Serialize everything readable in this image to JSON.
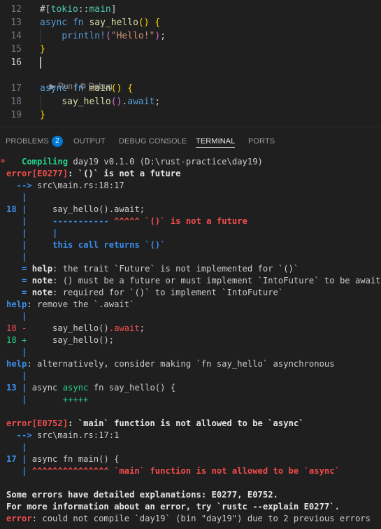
{
  "editor": {
    "lines": [
      {
        "num": "12",
        "parts": [
          [
            "#[",
            "t-attr"
          ],
          [
            "tokio",
            "t-path"
          ],
          [
            "::",
            "t-attr"
          ],
          [
            "main",
            "t-path"
          ],
          [
            "]",
            "t-attr"
          ]
        ]
      },
      {
        "num": "13",
        "parts": [
          [
            "async",
            "t-kw"
          ],
          [
            " ",
            "t-punc"
          ],
          [
            "fn",
            "t-kw"
          ],
          [
            " ",
            "t-punc"
          ],
          [
            "say_hello",
            "t-fn"
          ],
          [
            "()",
            "t-b1"
          ],
          [
            " ",
            "t-punc"
          ],
          [
            "{",
            "t-b1"
          ]
        ]
      },
      {
        "num": "14",
        "parts": [
          [
            "    ",
            "t-punc"
          ],
          [
            "println!",
            "t-kw"
          ],
          [
            "(",
            "t-b2"
          ],
          [
            "\"Hello!\"",
            "t-str"
          ],
          [
            ")",
            "t-b2"
          ],
          [
            ";",
            "t-punc"
          ]
        ]
      },
      {
        "num": "15",
        "parts": [
          [
            "}",
            "t-b1"
          ]
        ]
      },
      {
        "num": "16",
        "parts": []
      },
      {
        "num": "17",
        "parts": [
          [
            "async",
            "t-kw"
          ],
          [
            " ",
            "t-punc"
          ],
          [
            "fn",
            "t-kw"
          ],
          [
            " ",
            "t-punc"
          ],
          [
            "main",
            "t-fn"
          ],
          [
            "()",
            "t-b1"
          ],
          [
            " ",
            "t-punc"
          ],
          [
            "{",
            "t-b1"
          ]
        ]
      },
      {
        "num": "18",
        "parts": [
          [
            "    ",
            "t-punc"
          ],
          [
            "say_hello",
            "t-fn"
          ],
          [
            "()",
            "t-b2"
          ],
          [
            ".",
            "t-punc"
          ],
          [
            "await",
            "t-kw"
          ],
          [
            ";",
            "t-punc"
          ]
        ]
      },
      {
        "num": "19",
        "parts": [
          [
            "}",
            "t-b1"
          ]
        ]
      }
    ],
    "codelens": {
      "run_label": "Run",
      "separator": " | ",
      "debug_label": "Debug"
    }
  },
  "panel": {
    "tabs": [
      {
        "label": "PROBLEMS",
        "badge": "2",
        "active": false
      },
      {
        "label": "OUTPUT",
        "active": false
      },
      {
        "label": "DEBUG CONSOLE",
        "active": false
      },
      {
        "label": "TERMINAL",
        "active": true
      },
      {
        "label": "PORTS",
        "active": false
      }
    ]
  },
  "terminal": {
    "lines": [
      [
        [
          "   Compiling",
          "c-green c-bold"
        ],
        [
          " day19 v0.1.0 (D:\\rust-practice\\day19)",
          "c-norm"
        ]
      ],
      [
        [
          "error[E0277]",
          "c-red c-bold"
        ],
        [
          ": `()` is not a future",
          "c-white c-bold"
        ]
      ],
      [
        [
          "  --> ",
          "c-blue c-bold"
        ],
        [
          "src\\main.rs:18:17",
          "c-norm"
        ]
      ],
      [
        [
          "   |",
          "c-blue c-bold"
        ]
      ],
      [
        [
          "18 |",
          "c-blue c-bold"
        ],
        [
          "     say_hello().await;",
          "c-norm"
        ]
      ],
      [
        [
          "   |",
          "c-blue c-bold"
        ],
        [
          "     ----------- ",
          "c-blue c-bold"
        ],
        [
          "^^^^^ `()` is not a future",
          "c-red c-bold"
        ]
      ],
      [
        [
          "   |",
          "c-blue c-bold"
        ],
        [
          "     |",
          "c-blue c-bold"
        ]
      ],
      [
        [
          "   |",
          "c-blue c-bold"
        ],
        [
          "     this call returns `()`",
          "c-blue c-bold"
        ]
      ],
      [
        [
          "   |",
          "c-blue c-bold"
        ]
      ],
      [
        [
          "   = ",
          "c-blue c-bold"
        ],
        [
          "help",
          "c-white c-bold"
        ],
        [
          ": the trait `Future` is not implemented for `()`",
          "c-norm"
        ]
      ],
      [
        [
          "   = ",
          "c-blue c-bold"
        ],
        [
          "note",
          "c-white c-bold"
        ],
        [
          ": () must be a future or must implement `IntoFuture` to be awaited",
          "c-norm"
        ]
      ],
      [
        [
          "   = ",
          "c-blue c-bold"
        ],
        [
          "note",
          "c-white c-bold"
        ],
        [
          ": required for `()` to implement `IntoFuture`",
          "c-norm"
        ]
      ],
      [
        [
          "help",
          "c-blue c-bold"
        ],
        [
          ": remove the `.await`",
          "c-norm"
        ]
      ],
      [
        [
          "   |",
          "c-blue c-bold"
        ]
      ],
      [
        [
          "18 - ",
          "c-red"
        ],
        [
          "    say_hello()",
          "c-norm"
        ],
        [
          ".await",
          "c-red"
        ],
        [
          ";",
          "c-norm"
        ]
      ],
      [
        [
          "18 + ",
          "c-green"
        ],
        [
          "    say_hello();",
          "c-norm"
        ]
      ],
      [
        [
          "   |",
          "c-blue c-bold"
        ]
      ],
      [
        [
          "help",
          "c-blue c-bold"
        ],
        [
          ": alternatively, consider making `fn say_hello` asynchronous",
          "c-norm"
        ]
      ],
      [
        [
          "   |",
          "c-blue c-bold"
        ]
      ],
      [
        [
          "13 | ",
          "c-blue c-bold"
        ],
        [
          "async ",
          "c-norm"
        ],
        [
          "async ",
          "c-green"
        ],
        [
          "fn say_hello() {",
          "c-norm"
        ]
      ],
      [
        [
          "   | ",
          "c-blue c-bold"
        ],
        [
          "      +++++",
          "c-green"
        ]
      ],
      [
        [
          "",
          "c-norm"
        ]
      ],
      [
        [
          "error[E0752]",
          "c-red c-bold"
        ],
        [
          ": `main` function is not allowed to be `async`",
          "c-white c-bold"
        ]
      ],
      [
        [
          "  --> ",
          "c-blue c-bold"
        ],
        [
          "src\\main.rs:17:1",
          "c-norm"
        ]
      ],
      [
        [
          "   |",
          "c-blue c-bold"
        ]
      ],
      [
        [
          "17 | ",
          "c-blue c-bold"
        ],
        [
          "async fn main() {",
          "c-norm"
        ]
      ],
      [
        [
          "   | ",
          "c-blue c-bold"
        ],
        [
          "^^^^^^^^^^^^^^^ `main` function is not allowed to be `async`",
          "c-red c-bold"
        ]
      ],
      [
        [
          "",
          "c-norm"
        ]
      ],
      [
        [
          "Some errors have detailed explanations: E0277, E0752.",
          "c-white c-bold"
        ]
      ],
      [
        [
          "For more information about an error, try `rustc --explain E0277`.",
          "c-white c-bold"
        ]
      ],
      [
        [
          "error",
          "c-red c-bold"
        ],
        [
          ": could not compile `day19` (bin \"day19\") due to 2 previous errors",
          "c-norm"
        ]
      ]
    ]
  }
}
